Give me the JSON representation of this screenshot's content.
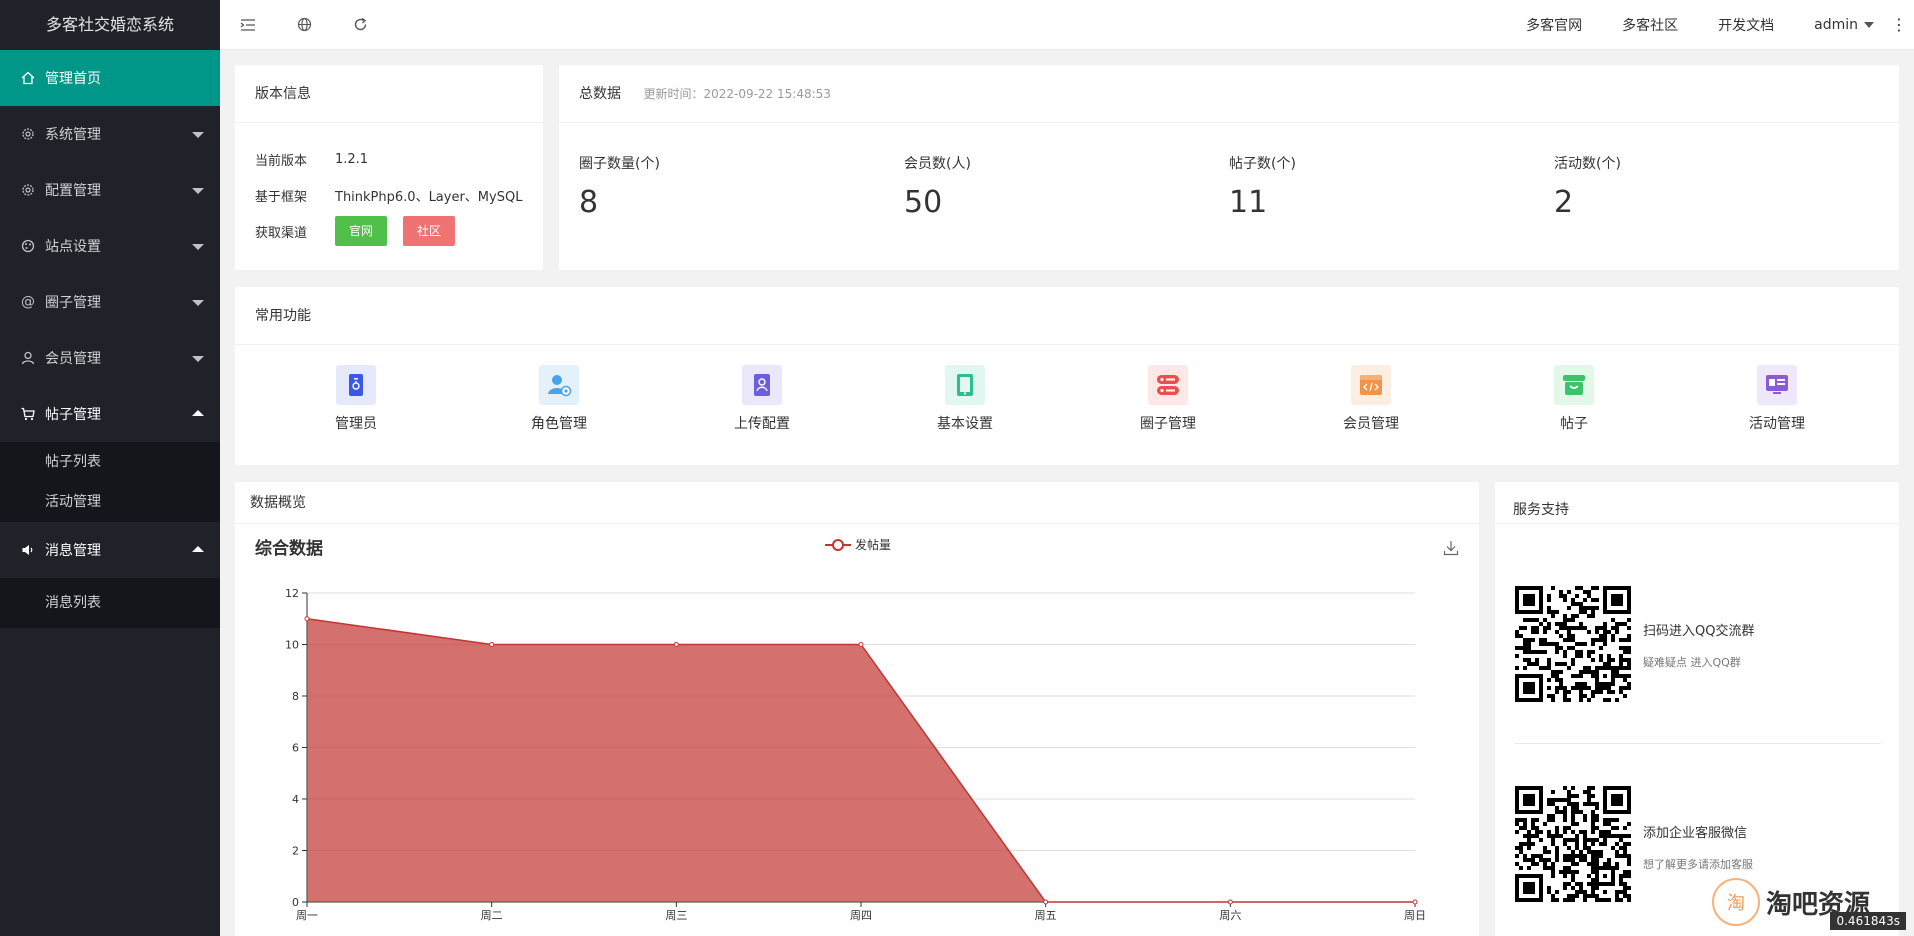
{
  "app": {
    "title": "多客社交婚恋系统"
  },
  "sidebar": {
    "items": [
      {
        "label": "管理首页",
        "icon": "home-icon",
        "active": true
      },
      {
        "label": "系统管理",
        "icon": "gear-icon"
      },
      {
        "label": "配置管理",
        "icon": "gear-icon"
      },
      {
        "label": "站点设置",
        "icon": "palette-icon"
      },
      {
        "label": "圈子管理",
        "icon": "at-icon"
      },
      {
        "label": "会员管理",
        "icon": "user-icon"
      },
      {
        "label": "帖子管理",
        "icon": "cart-icon",
        "open": true,
        "children": [
          "帖子列表",
          "活动管理"
        ]
      },
      {
        "label": "消息管理",
        "icon": "speaker-icon",
        "open": true,
        "children": [
          "消息列表"
        ]
      }
    ]
  },
  "header": {
    "links": [
      "多客官网",
      "多客社区",
      "开发文档"
    ],
    "user": "admin",
    "more": "⋮"
  },
  "version_card": {
    "title": "版本信息",
    "rows": [
      {
        "k": "当前版本",
        "v": "1.2.1"
      },
      {
        "k": "基于框架",
        "v": "ThinkPhp6.0、Layer、MySQL"
      },
      {
        "k": "获取渠道"
      }
    ],
    "btn_official": "官网",
    "btn_community": "社区"
  },
  "totals_card": {
    "title": "总数据",
    "updated": "更新时间：2022-09-22 15:48:53",
    "stats": [
      {
        "label": "圈子数量(个)",
        "value": "8"
      },
      {
        "label": "会员数(人)",
        "value": "50"
      },
      {
        "label": "帖子数(个)",
        "value": "11"
      },
      {
        "label": "活动数(个)",
        "value": "2"
      }
    ]
  },
  "functions_card": {
    "title": "常用功能",
    "items": [
      {
        "label": "管理员",
        "bg": "#e6e9fb",
        "fg": "#3b57e8"
      },
      {
        "label": "角色管理",
        "bg": "#e4f1fb",
        "fg": "#4aa3e8"
      },
      {
        "label": "上传配置",
        "bg": "#ebe8fb",
        "fg": "#6a5fdc"
      },
      {
        "label": "基本设置",
        "bg": "#e2f7f1",
        "fg": "#2dbd8f"
      },
      {
        "label": "圈子管理",
        "bg": "#fde8e8",
        "fg": "#ee4d4d"
      },
      {
        "label": "会员管理",
        "bg": "#fdeee2",
        "fg": "#f39345"
      },
      {
        "label": "帖子",
        "bg": "#e4f8ea",
        "fg": "#3bc46a"
      },
      {
        "label": "活动管理",
        "bg": "#efe7fb",
        "fg": "#8a5bd9"
      }
    ]
  },
  "overview_card": {
    "title": "数据概览",
    "chart_title": "综合数据"
  },
  "chart_data": {
    "type": "area",
    "title": "综合数据",
    "categories": [
      "周一",
      "周二",
      "周三",
      "周四",
      "周五",
      "周六",
      "周日"
    ],
    "series": [
      {
        "name": "发帖量",
        "values": [
          11,
          10,
          10,
          10,
          0,
          0,
          0
        ]
      }
    ],
    "yticks": [
      "0",
      "2",
      "4",
      "6",
      "8",
      "10",
      "12"
    ],
    "ylim": [
      0,
      12
    ],
    "grid": true,
    "legend": "top-center",
    "color": "#c23531"
  },
  "support_card": {
    "title": "服务支持",
    "items": [
      {
        "line1": "扫码进入QQ交流群",
        "line2": "疑难疑点 进入QQ群"
      },
      {
        "line1": "添加企业客服微信",
        "line2": "想了解更多请添加客服"
      }
    ]
  },
  "watermark": {
    "text": "淘吧资源",
    "glyph": "淘"
  },
  "timer": "0.461843s",
  "colors": {
    "sidebar": "#20222a",
    "active": "#009688"
  }
}
